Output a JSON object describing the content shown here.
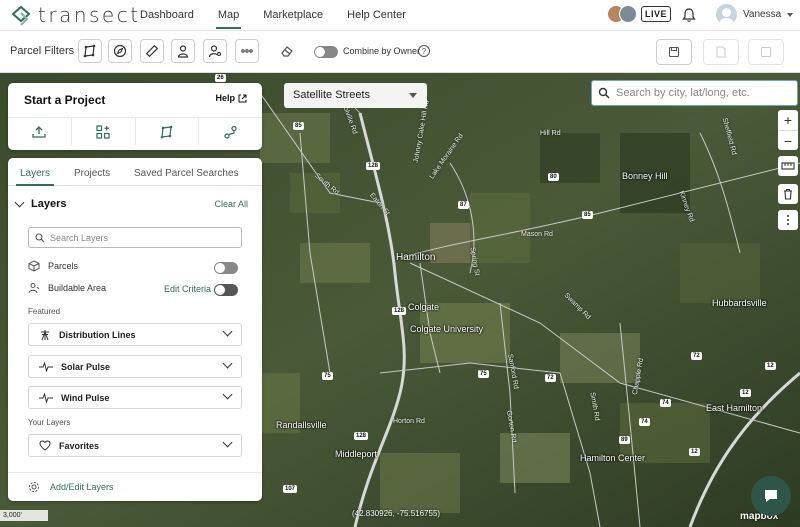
{
  "app": {
    "brand": "transect"
  },
  "nav": {
    "links": [
      "Dashboard",
      "Map",
      "Marketplace",
      "Help Center"
    ],
    "active": "Map",
    "live_label": "LIVE",
    "user_name": "Vanessa"
  },
  "filters": {
    "label": "Parcel Filters",
    "combine_label": "Combine by Owner",
    "combine_on": false
  },
  "map": {
    "style_select": "Satellite Streets",
    "search_placeholder": "Search by city, lat/long, etc.",
    "coords": "(42.830926, -75.516755)",
    "scale": "3,000'",
    "attribution": "mapbox",
    "places": [
      "Hamilton",
      "Colgate",
      "Colgate University",
      "Hubbardsville",
      "East Hamilton",
      "Hamilton Center",
      "Randallsville",
      "Middleport",
      "Bonney Hill"
    ],
    "roads": [
      "Lake Moraine Rd",
      "Johnny Cake Hill Rd",
      "Poolville Rd",
      "South Rd",
      "Eaton St",
      "Mason Rd",
      "Spring St",
      "Horton Rd",
      "Hill Rd",
      "Sanford Rd",
      "Chapple Rd",
      "Smith Rd",
      "Gorton Rd",
      "Kinney Rd",
      "Sheffield Rd",
      "Swamp Rd"
    ],
    "shields": [
      "26",
      "85",
      "128",
      "87",
      "128",
      "12",
      "75",
      "75",
      "72",
      "72",
      "74",
      "12",
      "89",
      "128",
      "74",
      "12",
      "107",
      "85",
      "80"
    ],
    "controls": [
      "+",
      "−"
    ]
  },
  "start_project": {
    "title": "Start a Project",
    "help_label": "Help"
  },
  "layers_panel": {
    "tabs": [
      "Layers",
      "Projects",
      "Saved Parcel Searches"
    ],
    "active_tab": "Layers",
    "section_title": "Layers",
    "clear_all": "Clear All",
    "search_placeholder": "Search Layers",
    "parcels_label": "Parcels",
    "buildable_label": "Buildable Area",
    "edit_criteria": "Edit Criteria",
    "featured_label": "Featured",
    "featured": [
      "Distribution Lines",
      "Solar Pulse",
      "Wind Pulse"
    ],
    "your_layers_label": "Your Layers",
    "favorites": "Favorites",
    "footer": "Add/Edit Layers"
  },
  "colors": {
    "accent": "#2f6f5e",
    "chat": "#2d5648",
    "search_border": "#6fa3d8"
  }
}
